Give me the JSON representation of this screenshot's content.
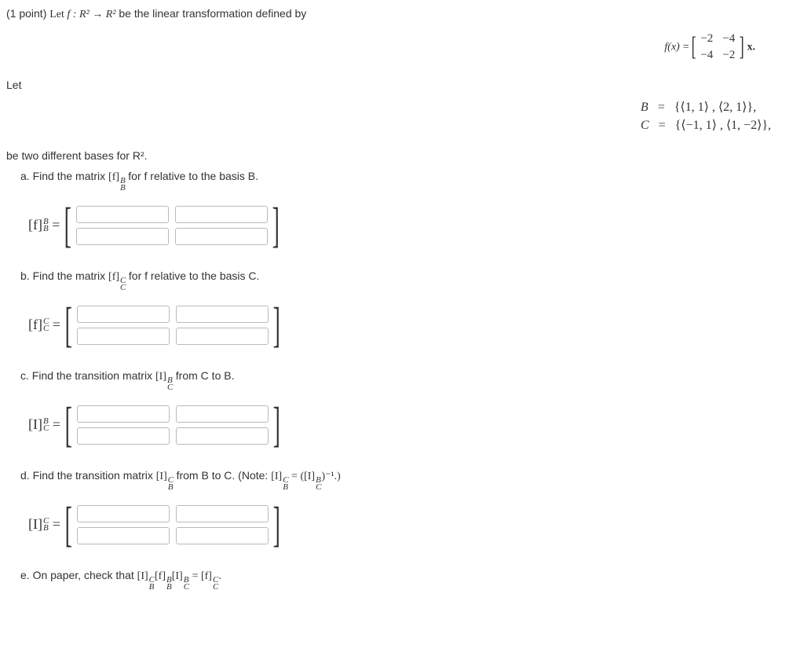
{
  "points": "(1 point)",
  "intro": "be the linear transformation defined by",
  "f_map": "f : R² → R²",
  "fx_lhs": "f(x)",
  "fx_matrix": [
    [
      "−2",
      "−4"
    ],
    [
      "−4",
      "−2"
    ]
  ],
  "fx_tail": "x.",
  "let": "Let",
  "bases": {
    "B_label": "B",
    "B_def": "{⟨1, 1⟩ , ⟨2, 1⟩},",
    "C_label": "C",
    "C_def": "{⟨−1, 1⟩ , ⟨1, −2⟩},"
  },
  "two_bases": "be two different bases for R².",
  "parts": {
    "a": {
      "text": "a. Find the matrix",
      "sym_core": "[f]",
      "sup": "B",
      "sub": "B",
      "tail": "for f relative to the basis B.",
      "lhs_core": "[f]",
      "lhs_sup": "B",
      "lhs_sub": "B"
    },
    "b": {
      "text": "b. Find the matrix",
      "sym_core": "[f]",
      "sup": "C",
      "sub": "C",
      "tail": "for f relative to the basis C.",
      "lhs_core": "[f]",
      "lhs_sup": "C",
      "lhs_sub": "C"
    },
    "c": {
      "text": "c. Find the transition matrix",
      "sym_core": "[I]",
      "sup": "B",
      "sub": "C",
      "tail": "from C to B.",
      "lhs_core": "[I]",
      "lhs_sup": "B",
      "lhs_sub": "C"
    },
    "d": {
      "text": "d. Find the transition matrix",
      "sym_core": "[I]",
      "sup": "C",
      "sub": "B",
      "tail_pre": "from B to C. (Note:",
      "note_lhs_core": "[I]",
      "note_lhs_sup": "C",
      "note_lhs_sub": "B",
      "note_rhs_core": "([I]",
      "note_rhs_sup": "B",
      "note_rhs_sub": "C",
      "note_rhs_tail": ")⁻¹.)",
      "lhs_core": "[I]",
      "lhs_sup": "C",
      "lhs_sub": "B"
    },
    "e": {
      "text": "e. On paper, check that",
      "eq_parts": [
        {
          "core": "[I]",
          "sup": "C",
          "sub": "B"
        },
        {
          "core": "[f]",
          "sup": "B",
          "sub": "B"
        },
        {
          "core": "[I]",
          "sup": "B",
          "sub": "C"
        }
      ],
      "eq_rhs": {
        "core": "[f]",
        "sup": "C",
        "sub": "C"
      },
      "eq_sign": " = ",
      "period": "."
    }
  }
}
